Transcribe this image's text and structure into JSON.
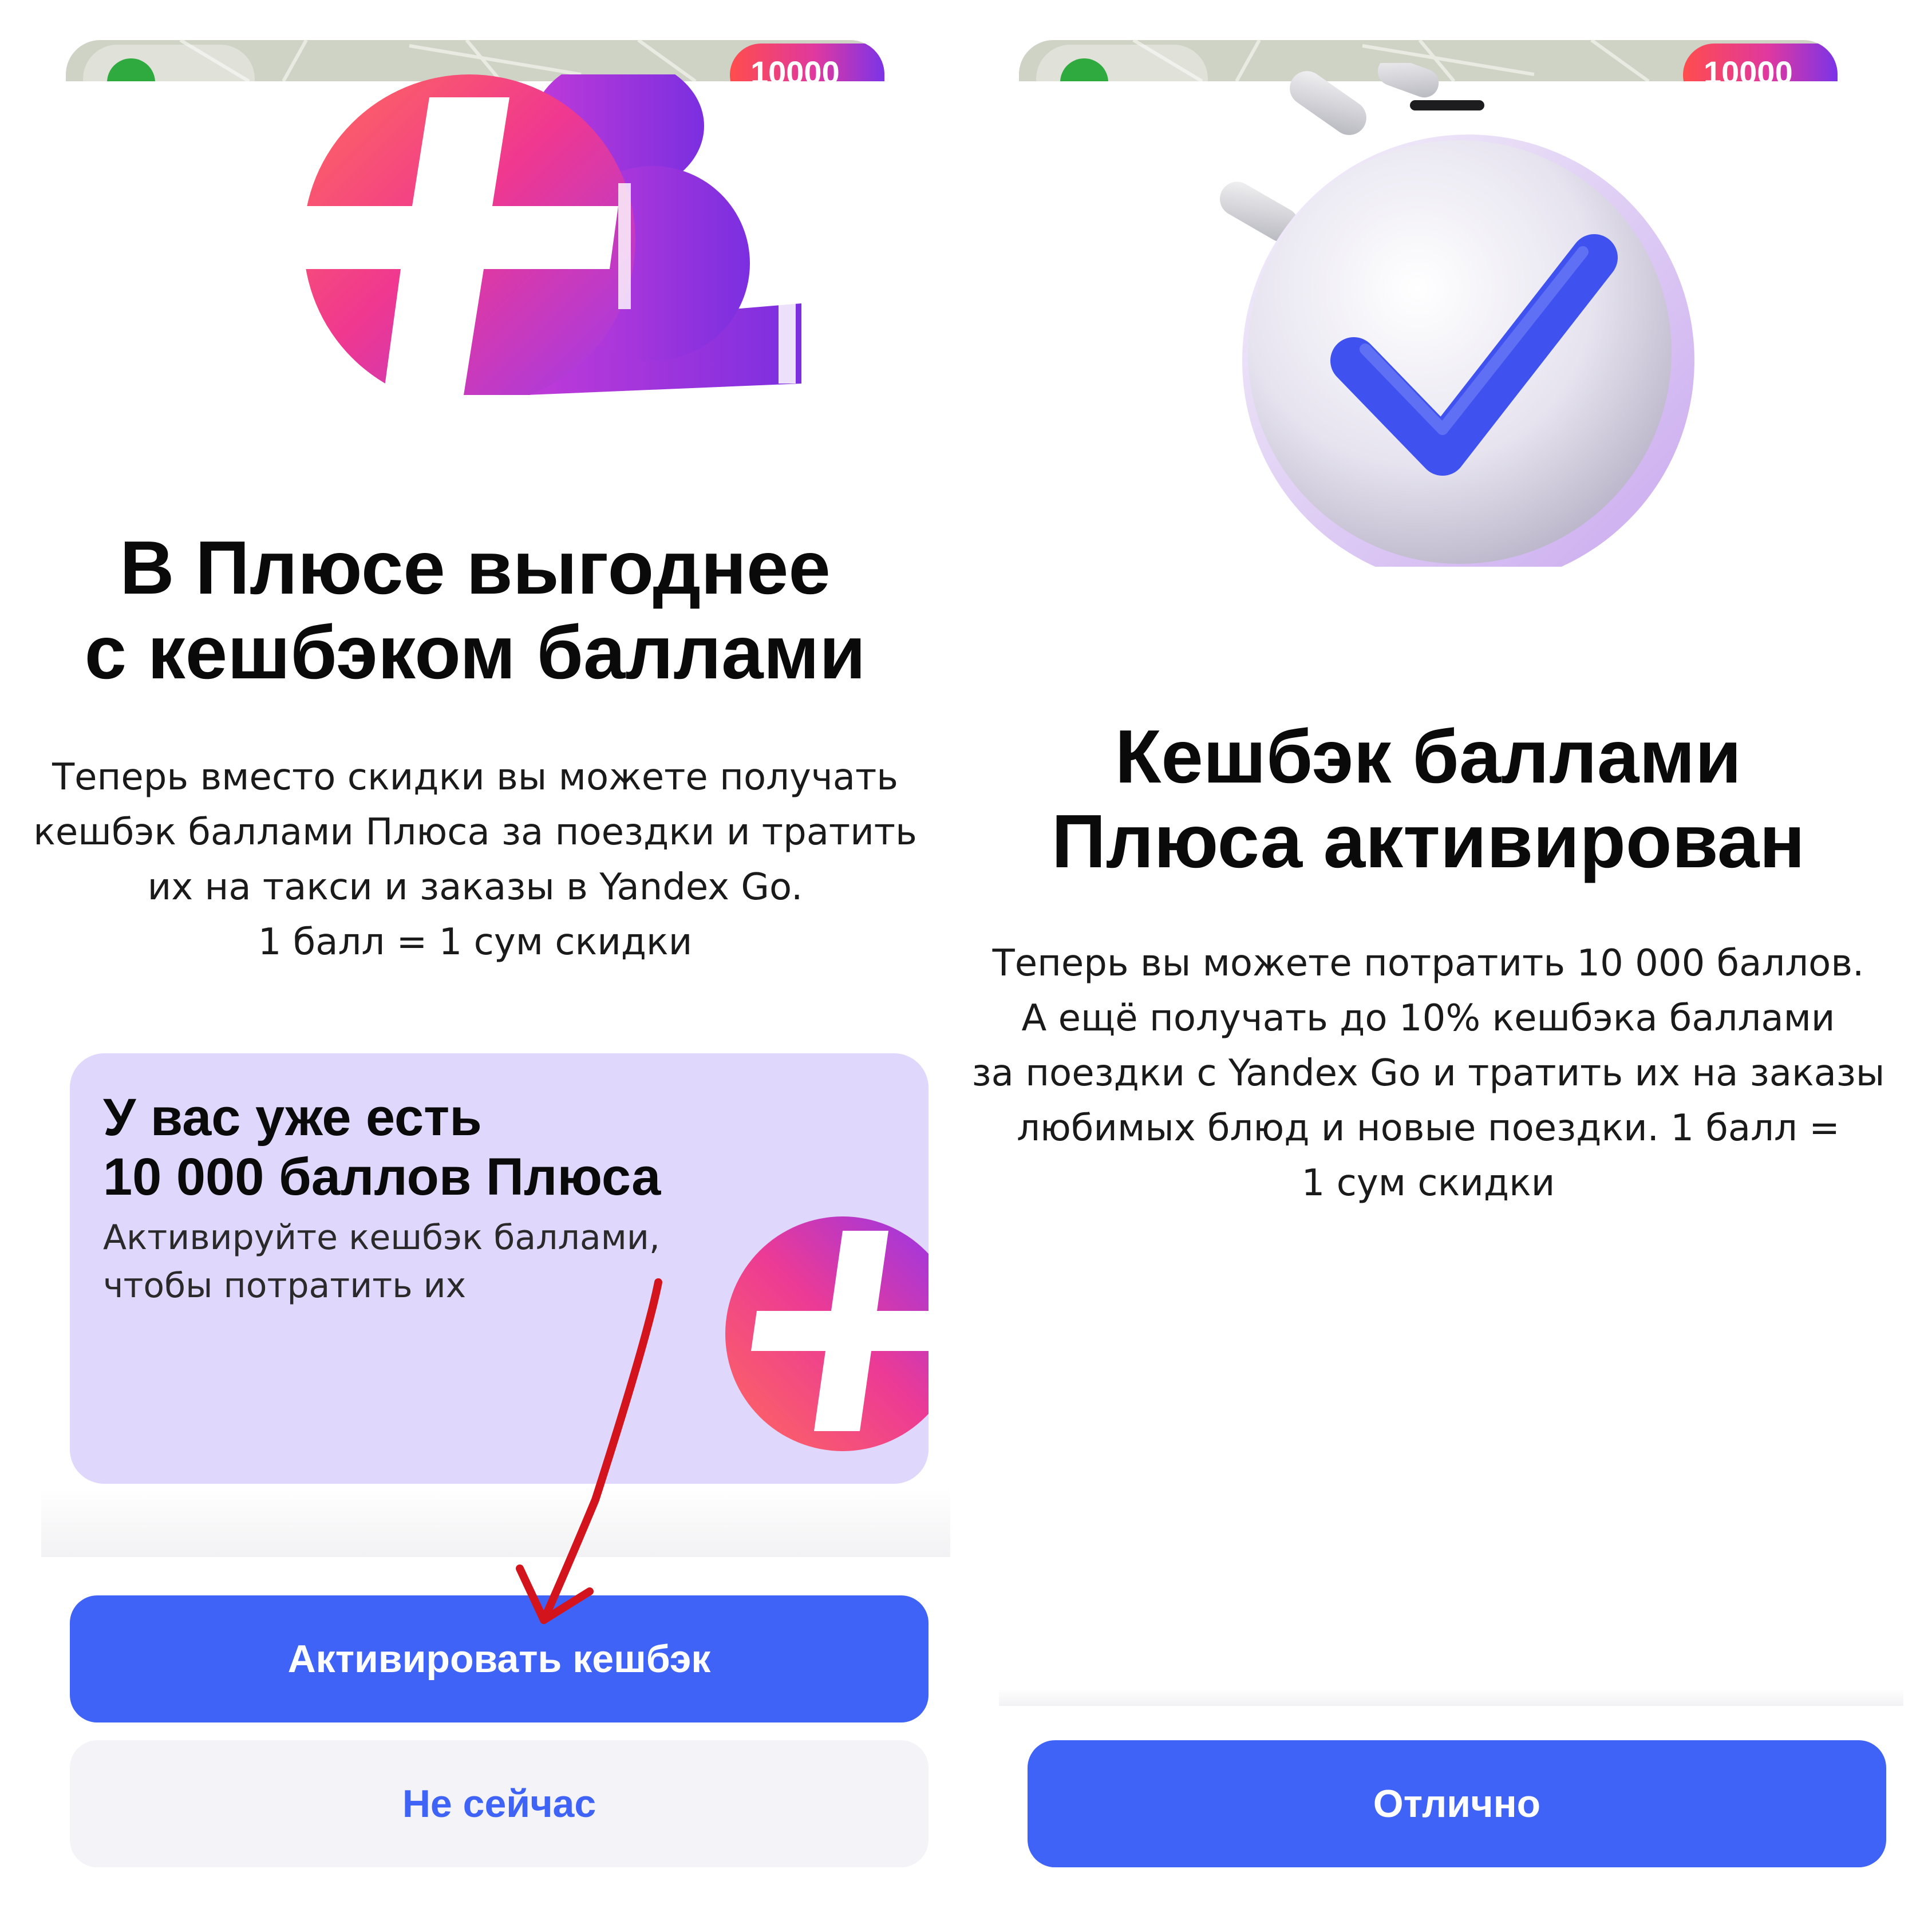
{
  "screen_left": {
    "map_balance": "10000",
    "title_lines": [
      "В Плюсе выгоднее",
      "с кешбэком баллами"
    ],
    "description_lines": [
      "Теперь вместо скидки вы можете получать",
      "кешбэк баллами Плюса за поездки и тратить",
      "их на такси и заказы в Yandex Go.",
      "1 балл = 1 сум скидки"
    ],
    "card": {
      "title_lines": [
        "У вас уже есть",
        "10 000 баллов Плюса"
      ],
      "text_lines": [
        "Активируйте кешбэк баллами,",
        "чтобы потратить их"
      ]
    },
    "primary_button": "Активировать кешбэк",
    "secondary_button": "Не сейчас"
  },
  "screen_right": {
    "map_balance": "10000",
    "title_lines": [
      "Кешбэк баллами",
      "Плюса активирован"
    ],
    "description_lines": [
      "Теперь вы можете потратить 10 000 баллов.",
      "А ещё получать до 10% кешбэка баллами",
      "за поездки с Yandex Go и тратить их на заказы",
      "любимых блюд и новые поездки. 1 балл =",
      "1 сум скидки"
    ],
    "primary_button": "Отлично"
  },
  "colors": {
    "accent_blue": "#3f63f6",
    "card_lavender": "#e0d8fc",
    "annotation_red": "#d4141c"
  },
  "icons": [
    "plus-coin-icon",
    "checkmark-coin-icon",
    "red-arrow-annotation"
  ]
}
